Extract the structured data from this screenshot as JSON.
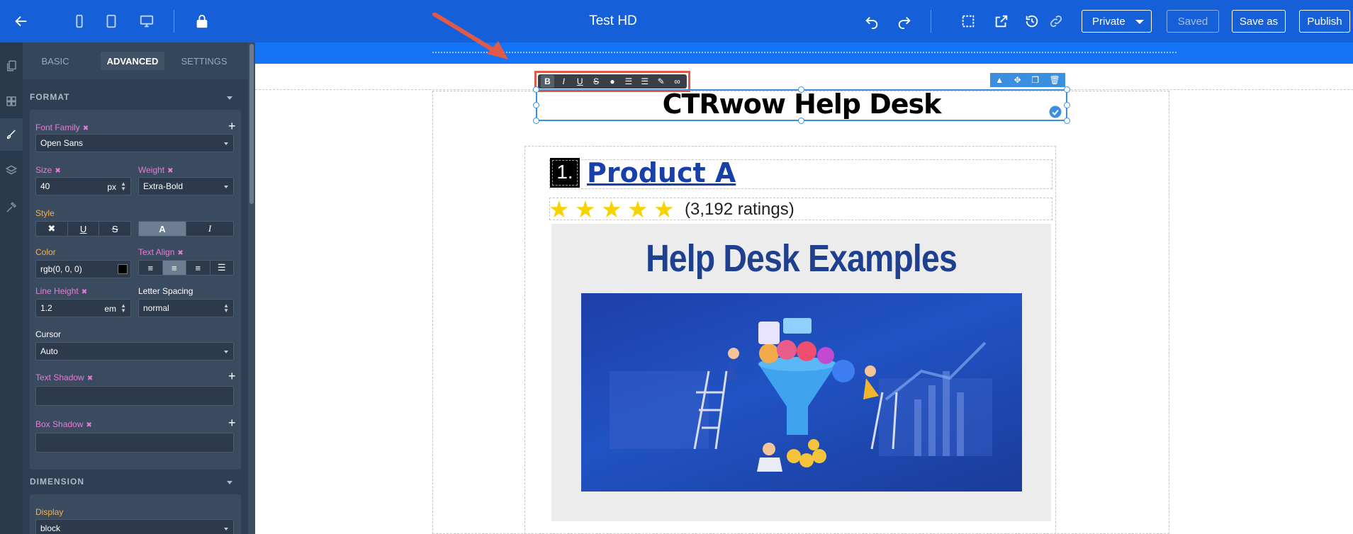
{
  "topbar": {
    "title": "Test HD",
    "visibility": "Private",
    "saved_label": "Saved",
    "save_as_label": "Save as",
    "publish_label": "Publish"
  },
  "panel": {
    "tabs": [
      "BASIC",
      "ADVANCED",
      "SETTINGS"
    ],
    "active_tab": "ADVANCED",
    "format": {
      "heading": "FORMAT",
      "font_family_label": "Font Family",
      "font_family_value": "Open Sans",
      "size_label": "Size",
      "size_value": "40",
      "size_unit": "px",
      "weight_label": "Weight",
      "weight_value": "Extra-Bold",
      "style_label": "Style",
      "color_label": "Color",
      "color_value": "rgb(0, 0, 0)",
      "text_align_label": "Text Align",
      "line_height_label": "Line Height",
      "line_height_value": "1.2",
      "line_height_unit": "em",
      "letter_spacing_label": "Letter Spacing",
      "letter_spacing_value": "normal",
      "cursor_label": "Cursor",
      "cursor_value": "Auto",
      "text_shadow_label": "Text Shadow",
      "box_shadow_label": "Box Shadow"
    },
    "dimension": {
      "heading": "DIMENSION",
      "display_label": "Display",
      "display_value": "block"
    }
  },
  "canvas": {
    "heading": "CTRwow Help Desk",
    "item_number": "1.",
    "product_title": "Product A",
    "rating_stars": 5,
    "ratings_text": "(3,192 ratings)",
    "image_title": "Help Desk Examples"
  },
  "rte_toolbar": [
    "B",
    "I",
    "U",
    "S",
    "color",
    "bulleted-list",
    "numbered-list",
    "edit",
    "link"
  ],
  "colors": {
    "topbar": "#1560d8",
    "panel": "#2f3f53",
    "accent_pink": "#e97ad6",
    "accent_orange": "#f5b14b",
    "selection_blue": "#3b8fe0",
    "annotation_red": "#e05a47",
    "link_blue": "#1740a8",
    "star_yellow": "#f7d400"
  }
}
